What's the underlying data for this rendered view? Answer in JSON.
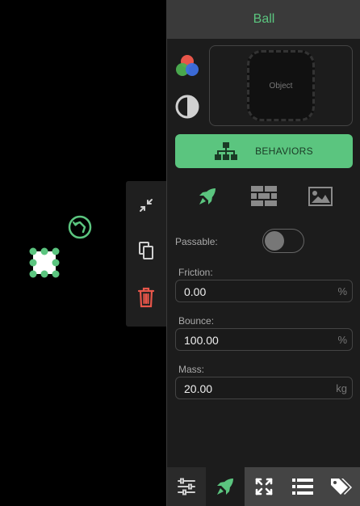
{
  "panel": {
    "title": "Ball",
    "object_label": "Object",
    "behaviors_label": "BEHAVIORS"
  },
  "physics": {
    "passable_label": "Passable:",
    "passable_on": false,
    "friction_label": "Friction:",
    "friction_value": "0.00",
    "friction_unit": "%",
    "bounce_label": "Bounce:",
    "bounce_value": "100.00",
    "bounce_unit": "%",
    "mass_label": "Mass:",
    "mass_value": "20.00",
    "mass_unit": "kg"
  },
  "colors": {
    "accent": "#5bc57f",
    "delete": "#e8564a",
    "background": "#000000",
    "panel": "#1c1c1c"
  },
  "icons": {
    "context_toolbar": [
      "compress-icon",
      "copy-icon",
      "trash-icon"
    ],
    "behavior_tabs": [
      "rocket-icon",
      "brick-wall-icon",
      "image-icon"
    ],
    "bottom_tabs": [
      "sliders-icon",
      "rocket-icon",
      "expand-icon",
      "list-icon",
      "tags-icon"
    ]
  }
}
